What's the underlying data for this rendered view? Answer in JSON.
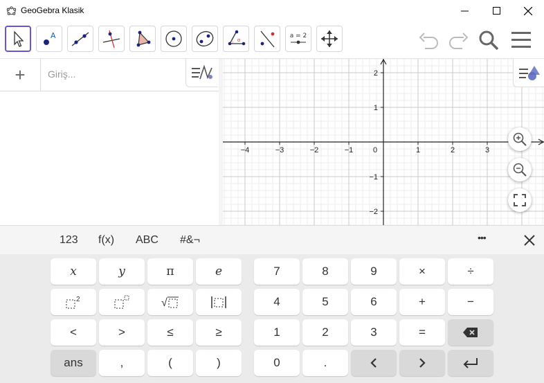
{
  "window": {
    "title": "GeoGebra Klasik"
  },
  "algebra": {
    "input_placeholder": "Giriş..."
  },
  "graph": {
    "x_ticks": [
      "−4",
      "−3",
      "−2",
      "−1",
      "0",
      "1",
      "2",
      "3"
    ],
    "y_ticks": [
      "2",
      "1",
      "−1",
      "−2"
    ]
  },
  "keyboard": {
    "tabs": [
      "123",
      "f(x)",
      "ABC",
      "#&¬"
    ],
    "more": "•••",
    "row1": [
      "x",
      "y",
      "π",
      "e",
      "7",
      "8",
      "9",
      "×",
      "÷"
    ],
    "row2": [
      "4",
      "5",
      "6",
      "+",
      "−"
    ],
    "row3": [
      "<",
      ">",
      "≤",
      "≥",
      "1",
      "2",
      "3",
      "="
    ],
    "row4": [
      "ans",
      ",",
      "(",
      ")",
      "0",
      "."
    ],
    "keys_misc": {
      "sq": "2",
      "sqrt": "√"
    }
  },
  "toolbar": {
    "slider_label": "a = 2"
  },
  "colors": {
    "accent": "#6557d2",
    "point": "#1a237e",
    "red": "#d32f2f"
  }
}
